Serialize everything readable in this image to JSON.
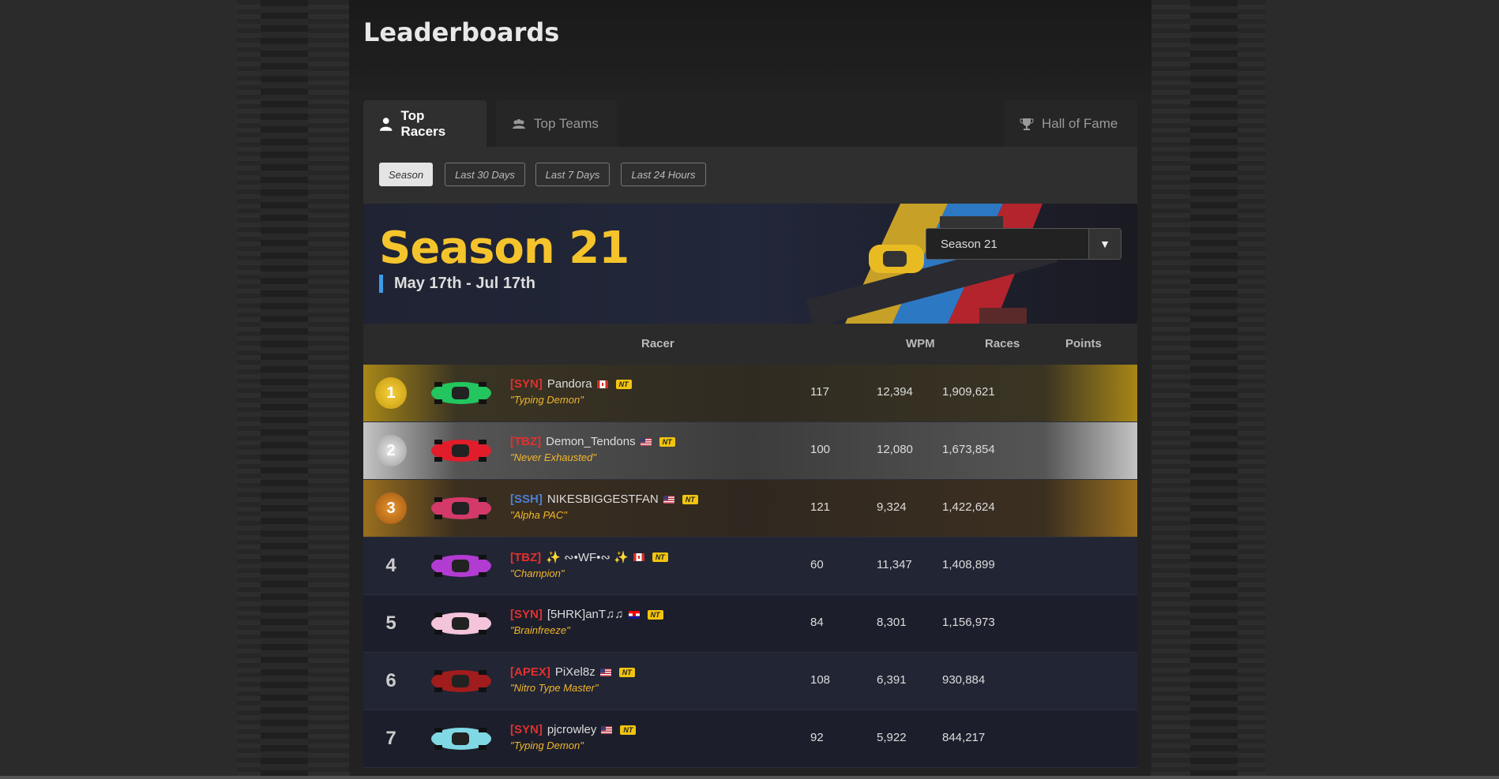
{
  "page": {
    "title": "Leaderboards"
  },
  "tabs": [
    {
      "label": "Top Racers",
      "icon": "user-icon",
      "active": true
    },
    {
      "label": "Top Teams",
      "icon": "team-icon",
      "active": false
    },
    {
      "label": "Hall of Fame",
      "icon": "trophy-icon",
      "active": false
    }
  ],
  "filters": [
    "Season",
    "Last 30 Days",
    "Last 7 Days",
    "Last 24 Hours"
  ],
  "season": {
    "title": "Season 21",
    "dates": "May 17th - Jul 17th",
    "select_value": "Season 21"
  },
  "table": {
    "headers": {
      "racer": "Racer",
      "wpm": "WPM",
      "races": "Races",
      "points": "Points"
    },
    "rows": [
      {
        "rank": "1",
        "tag": "[SYN]",
        "name": "Pandora",
        "flag": "CA",
        "title": "\"Typing Demon\"",
        "wpm": "117",
        "races": "12,394",
        "points": "1,909,621",
        "car": "#22c55e"
      },
      {
        "rank": "2",
        "tag": "[TBZ]",
        "name": "Demon_Tendons",
        "flag": "US",
        "title": "\"Never Exhausted\"",
        "wpm": "100",
        "races": "12,080",
        "points": "1,673,854",
        "car": "#e11d2b"
      },
      {
        "rank": "3",
        "tag": "[SSH]",
        "name": "NIKESBIGGESTFAN",
        "flag": "US",
        "title": "\"Alpha PAC\"",
        "wpm": "121",
        "races": "9,324",
        "points": "1,422,624",
        "car": "#d33a6a"
      },
      {
        "rank": "4",
        "tag": "[TBZ]",
        "name": "✨ ∾•WF•∾ ✨",
        "flag": "CA",
        "title": "\"Champion\"",
        "wpm": "60",
        "races": "11,347",
        "points": "1,408,899",
        "car": "#b23bd1"
      },
      {
        "rank": "5",
        "tag": "[SYN]",
        "name": "[5HRK]anT♫♫",
        "flag": "HR",
        "title": "\"Brainfreeze\"",
        "wpm": "84",
        "races": "8,301",
        "points": "1,156,973",
        "car": "#f3c4da"
      },
      {
        "rank": "6",
        "tag": "[APEX]",
        "name": "PiXel8z",
        "flag": "US",
        "title": "\"Nitro Type Master\"",
        "wpm": "108",
        "races": "6,391",
        "points": "930,884",
        "car": "#a11c1c"
      },
      {
        "rank": "7",
        "tag": "[SYN]",
        "name": "pjcrowley",
        "flag": "US",
        "title": "\"Typing Demon\"",
        "wpm": "92",
        "races": "5,922",
        "points": "844,217",
        "car": "#7fd8e4"
      }
    ]
  },
  "badge": "NT"
}
